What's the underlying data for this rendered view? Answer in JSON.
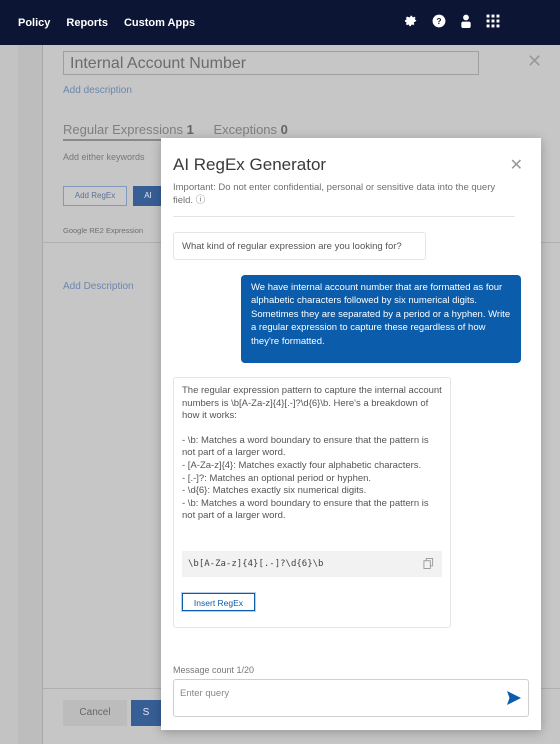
{
  "topnav": {
    "items": [
      "Policy",
      "Reports",
      "Custom Apps"
    ],
    "icons": [
      "gear-icon",
      "help-icon",
      "user-icon",
      "app-grid-icon"
    ]
  },
  "background": {
    "name_field_value": "Internal  Account Number",
    "add_description": "Add description",
    "tab_regex_label": "Regular Expressions",
    "tab_regex_count": "1",
    "tab_exceptions_label": "Exceptions",
    "tab_exceptions_count": "0",
    "helper_text": "Add either keywords",
    "add_regex_button": "Add RegEx",
    "ai_button": "AI",
    "column_header": "Google RE2 Expression",
    "add_description_2": "Add Description",
    "cancel_button": "Cancel",
    "save_button_partial": "S"
  },
  "modal": {
    "title": "AI RegEx Generator",
    "note": "Important: Do not enter confidential, personal or sensitive data into the query field.",
    "close_icon": "close-icon",
    "bot_question": "What kind of regular expression are you looking for?",
    "user_message": "We have internal account number that are formatted as four alphabetic characters followed by six numerical digits. Sometimes they are separated by a period or a hyphen. Write a regular expression to capture these regardless of how they're formatted.",
    "bot_answer_intro": "The regular expression pattern to capture the internal account numbers is \\b[A-Za-z]{4}[.-]?\\d{6}\\b. Here's a breakdown of how it works:",
    "bot_answer_points": [
      "- \\b: Matches a word boundary to ensure that the pattern is not part of a larger word.",
      "- [A-Za-z]{4}: Matches exactly four alphabetic characters.",
      "- [.-]?: Matches an optional period or hyphen.",
      "- \\d{6}: Matches exactly six numerical digits.",
      "- \\b: Matches a word boundary to ensure that the pattern is not part of a larger word."
    ],
    "code": "\\b[A-Za-z]{4}[.-]?\\d{6}\\b",
    "insert_button": "Insert RegEx",
    "message_count": "Message count 1/20",
    "query_placeholder": "Enter query",
    "accent_color": "#0b5cab"
  }
}
